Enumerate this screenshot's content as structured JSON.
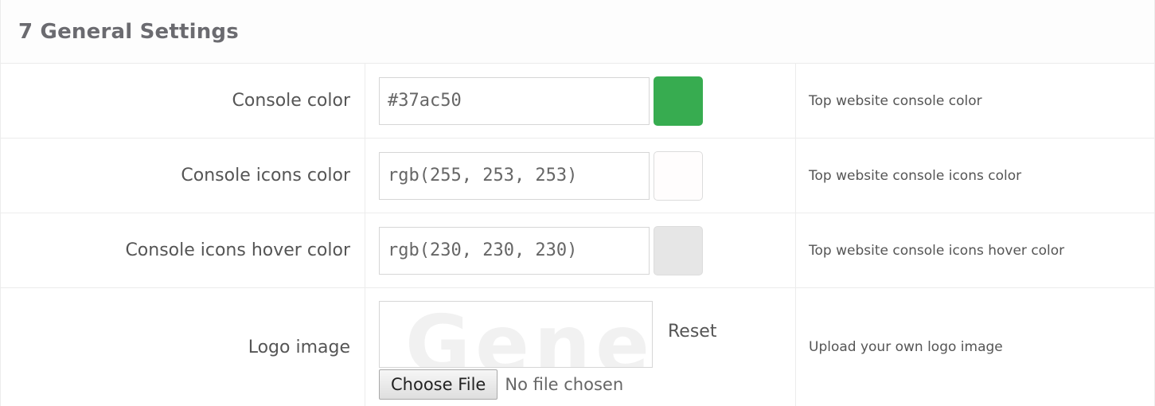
{
  "section": {
    "title": "7 General Settings"
  },
  "rows": [
    {
      "label": "Console color",
      "value": "#37ac50",
      "swatch_color": "#37ac50",
      "help": "Top website console color"
    },
    {
      "label": "Console icons color",
      "value": "rgb(255, 253, 253)",
      "swatch_color": "#fffdfd",
      "help": "Top website console icons color"
    },
    {
      "label": "Console icons hover color",
      "value": "rgb(230, 230, 230)",
      "swatch_color": "#e6e6e6",
      "help": "Top website console icons hover color"
    }
  ],
  "logo": {
    "label": "Logo image",
    "preview_text": "Gene",
    "reset_label": "Reset",
    "choose_file_label": "Choose File",
    "file_status": "No file chosen",
    "help": "Upload your own logo image"
  }
}
